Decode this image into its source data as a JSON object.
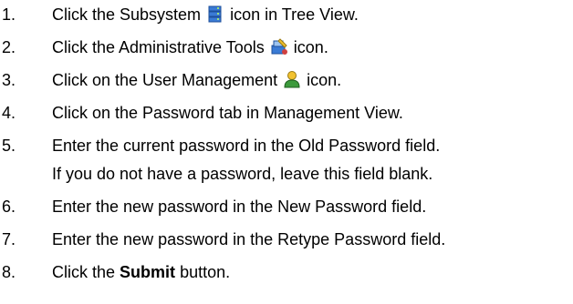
{
  "steps": [
    {
      "num": "1.",
      "before": "Click the Subsystem",
      "icon": "subsystem-icon",
      "after": "icon in Tree View."
    },
    {
      "num": "2.",
      "before": "Click the Administrative Tools",
      "icon": "administrative-tools-icon",
      "after": "icon."
    },
    {
      "num": "3.",
      "before": "Click on the User Management",
      "icon": "user-management-icon",
      "after": "icon."
    },
    {
      "num": "4.",
      "text": "Click on the Password tab in Management View."
    },
    {
      "num": "5.",
      "text": "Enter the current password in the Old Password field.",
      "continuation": "If you do not have a password, leave this field blank."
    },
    {
      "num": "6.",
      "text": "Enter the new password in the New Password field."
    },
    {
      "num": "7.",
      "text": "Enter the new password in the Retype Password field."
    },
    {
      "num": "8.",
      "before": "Click the",
      "bold": "Submit",
      "after": "button."
    }
  ],
  "colors": {
    "text": "#000000",
    "icon_blue": "#3a7bd5",
    "icon_yellow": "#f2c230",
    "icon_green": "#3c9a3c"
  }
}
